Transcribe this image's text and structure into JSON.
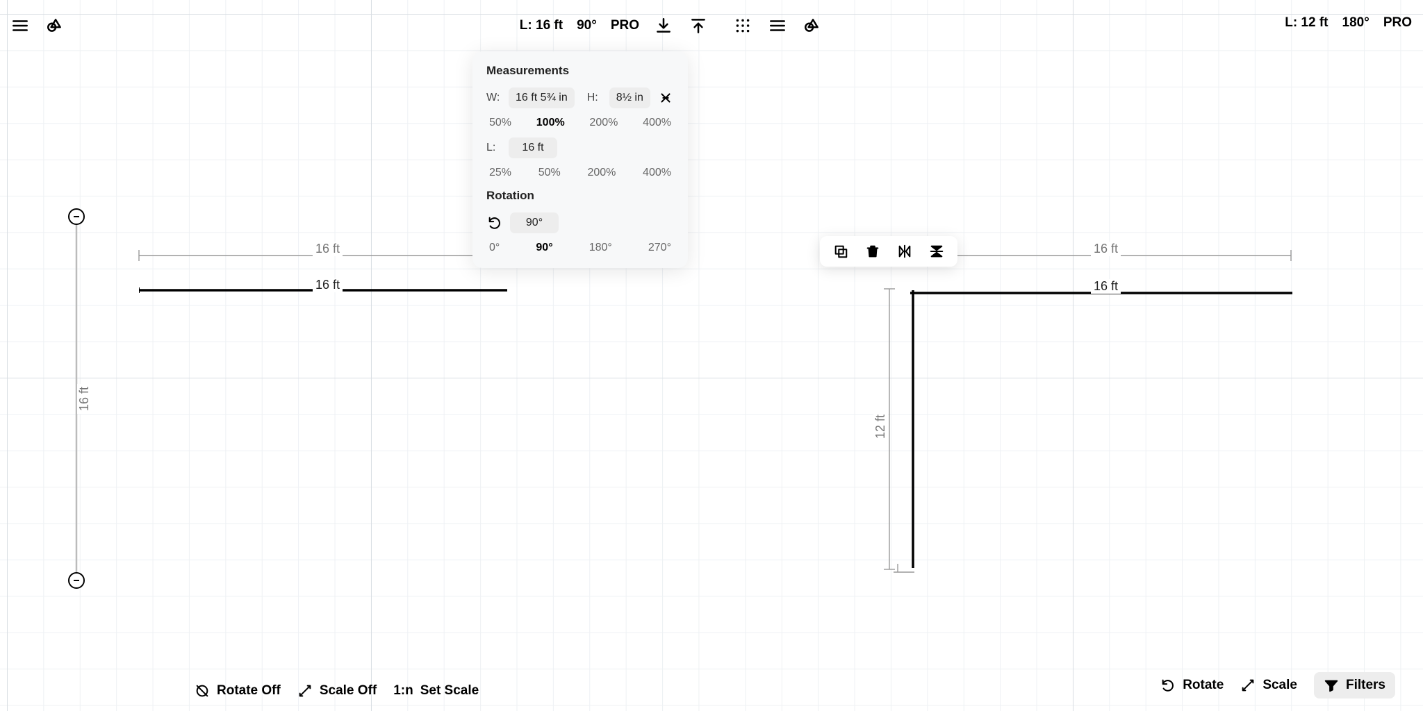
{
  "left": {
    "status": {
      "length": "L: 16 ft",
      "angle": "90°",
      "pro": "PRO"
    },
    "dims": {
      "h_top": "16 ft",
      "h_object": "16 ft",
      "v_object": "16 ft"
    },
    "popover": {
      "title_measurements": "Measurements",
      "w_label": "W:",
      "w_value": "16 ft 5¾ in",
      "h_label": "H:",
      "h_value": "8½ in",
      "scale_opts": [
        "50%",
        "100%",
        "200%",
        "400%"
      ],
      "scale_active_idx": 1,
      "l_label": "L:",
      "l_value": "16 ft",
      "l_scale_opts": [
        "25%",
        "50%",
        "200%",
        "400%"
      ],
      "title_rotation": "Rotation",
      "rotation_value": "90°",
      "rotation_opts": [
        "0°",
        "90°",
        "180°",
        "270°"
      ],
      "rotation_active_idx": 1
    },
    "bottom": {
      "rotate": "Rotate Off",
      "scale": "Scale Off",
      "ratio": "1:n",
      "setscale": "Set Scale"
    }
  },
  "right": {
    "status": {
      "length": "L: 12 ft",
      "angle": "180°",
      "pro": "PRO"
    },
    "dims": {
      "h_top": "16 ft",
      "h_object": "16 ft",
      "v_object": "12 ft"
    },
    "bottom": {
      "rotate": "Rotate",
      "scale": "Scale",
      "filters": "Filters"
    }
  }
}
